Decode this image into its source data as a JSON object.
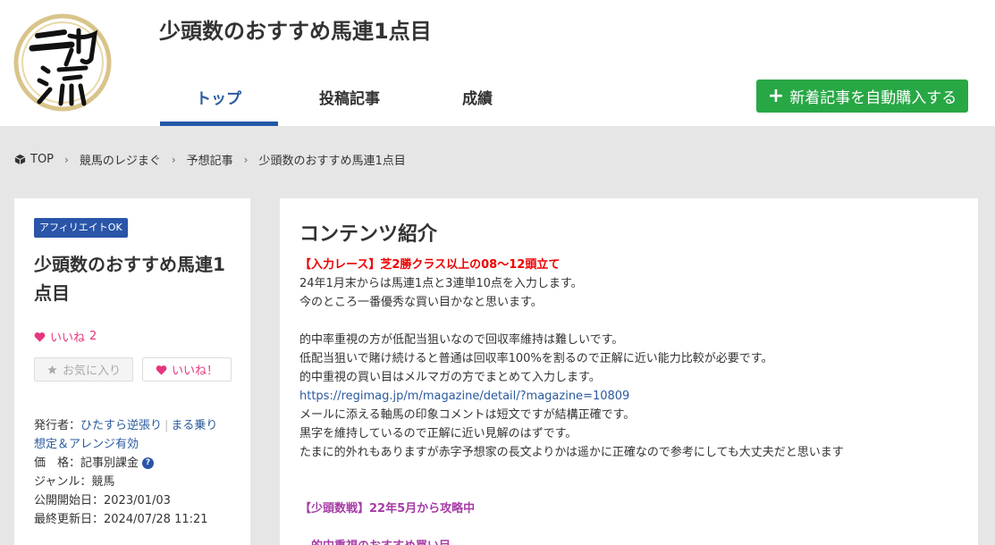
{
  "header": {
    "site_title": "少頭数のおすすめ馬連1点目",
    "tabs": [
      {
        "label": "トップ"
      },
      {
        "label": "投稿記事"
      },
      {
        "label": "成績"
      }
    ],
    "buy_button": {
      "plus": "+",
      "label": "新着記事を自動購入する"
    },
    "logo_text": "二刀流"
  },
  "breadcrumb": {
    "items": [
      "TOP",
      "競馬のレジまぐ",
      "予想記事",
      "少頭数のおすすめ馬連1点目"
    ],
    "separator": "›"
  },
  "sidebar": {
    "badge": "アフィリエイトOK",
    "title": "少頭数のおすすめ馬連1点目",
    "likes_label": "いいね",
    "likes_count": "2",
    "fav_button": "お気に入り",
    "like_button": "いいね！",
    "meta": {
      "publisher_label": "発行者：",
      "publisher_1": "ひたすら逆張り",
      "publisher_2": "まる乗り",
      "publisher_3": "想定＆アレンジ有効",
      "price_label": "価　格：",
      "price_value": "記事別課金",
      "help": "?",
      "genre_label": "ジャンル：",
      "genre_value": "競馬",
      "start_label": "公開開始日：",
      "start_value": "2023/01/03",
      "updated_label": "最終更新日：",
      "updated_value": "2024/07/28 11:21"
    }
  },
  "main": {
    "heading": "コンテンツ紹介",
    "line1": "【入力レース】芝2勝クラス以上の08～12頭立て",
    "line2": "24年1月末からは馬連1点と3連単10点を入力します。",
    "line3": "今のところ一番優秀な買い目かなと思います。",
    "line4": "的中率重視の方が低配当狙いなので回収率維持は難しいです。",
    "line5": "低配当狙いで賭け続けると普通は回収率100%を割るので正解に近い能力比較が必要です。",
    "line6": "的中重視の買い目はメルマガの方でまとめて入力します。",
    "link": "https://regimag.jp/m/magazine/detail/?magazine=10809",
    "line7": "メールに添える軸馬の印象コメントは短文ですが結構正確です。",
    "line8": "黒字を維持しているので正解に近い見解のはずです。",
    "line9": "たまに的外れもありますが赤字予想家の長文よりかは遥かに正確なので参考にしても大丈夫だと思います",
    "line10": "【少頭数戦】22年5月から攻略中",
    "line11": "―的中重視のおすすめ買い目―"
  },
  "colors": {
    "accent_blue": "#2358a8",
    "buy_green": "#28a745",
    "like_pink": "#e6367e",
    "highlight_red": "#ee0000",
    "highlight_purple": "#a63ca6"
  }
}
